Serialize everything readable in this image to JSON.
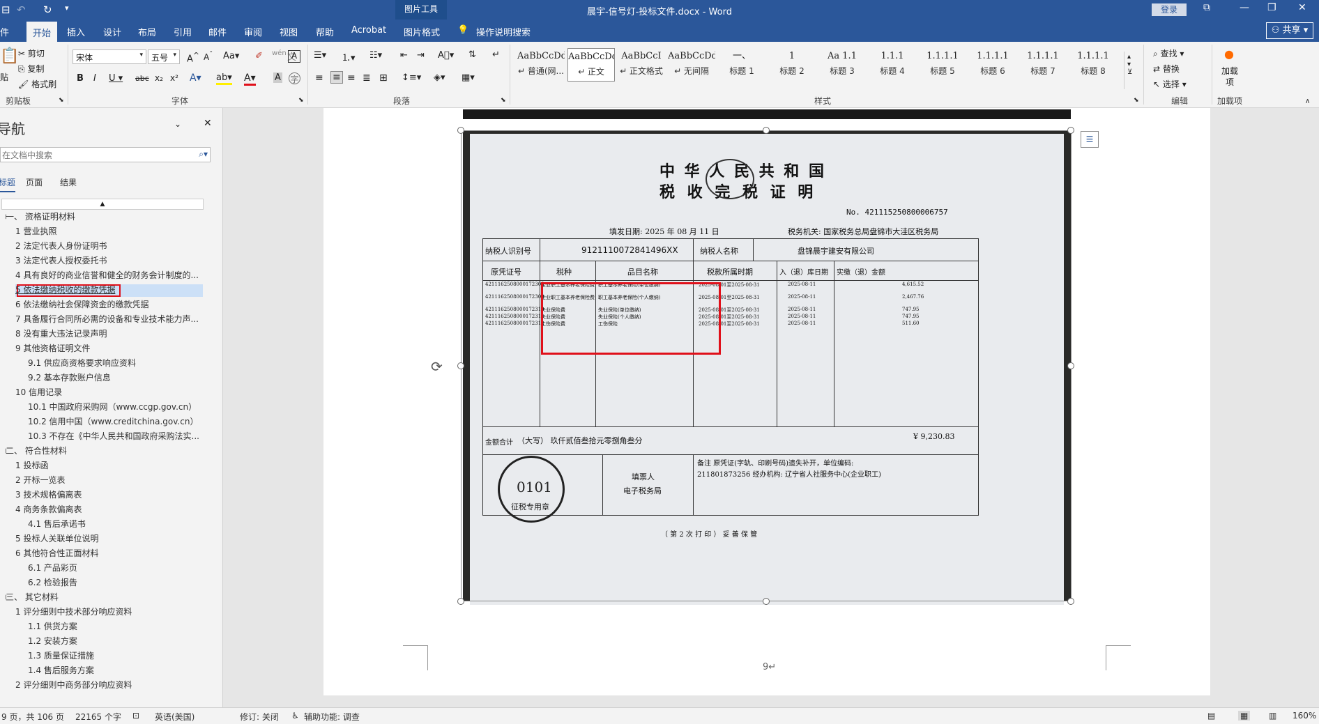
{
  "titlebar": {
    "context_tab": "图片工具",
    "doc_title": "晨宇-信号灯-投标文件.docx  -  Word",
    "login": "登录"
  },
  "tabs": [
    {
      "label": "件"
    },
    {
      "label": "开始"
    },
    {
      "label": "插入"
    },
    {
      "label": "设计"
    },
    {
      "label": "布局"
    },
    {
      "label": "引用"
    },
    {
      "label": "邮件"
    },
    {
      "label": "审阅"
    },
    {
      "label": "视图"
    },
    {
      "label": "帮助"
    },
    {
      "label": "Acrobat"
    },
    {
      "label": "图片格式"
    }
  ],
  "tell_me": "操作说明搜索",
  "share": "共享",
  "ribbon": {
    "clipboard": {
      "paste": "贴",
      "cut": "剪切",
      "copy": "复制",
      "format_painter": "格式刷",
      "label": "剪贴板"
    },
    "font": {
      "name": "宋体",
      "size": "五号",
      "label": "字体"
    },
    "paragraph": {
      "label": "段落"
    },
    "styles": {
      "label": "样式",
      "items": [
        {
          "preview": "AaBbCcDd",
          "name": "↵ 普通(网..."
        },
        {
          "preview": "AaBbCcDd",
          "name": "↵ 正文"
        },
        {
          "preview": "AaBbCcI",
          "name": "↵ 正文格式"
        },
        {
          "preview": "AaBbCcDdI",
          "name": "↵ 无间隔"
        },
        {
          "preview": "一、",
          "name": "标题 1"
        },
        {
          "preview": "1",
          "name": "标题 2"
        },
        {
          "preview": "Aa 1.1",
          "name": "标题 3"
        },
        {
          "preview": "1.1.1",
          "name": "标题 4"
        },
        {
          "preview": "1.1.1.1",
          "name": "标题 5"
        },
        {
          "preview": "1.1.1.1",
          "name": "标题 6"
        },
        {
          "preview": "1.1.1.1",
          "name": "标题 7"
        },
        {
          "preview": "1.1.1.1",
          "name": "标题 8"
        }
      ]
    },
    "editing": {
      "find": "查找",
      "replace": "替换",
      "select": "选择",
      "label": "编辑"
    },
    "addins": {
      "add": "加载项",
      "label": "加载项"
    }
  },
  "nav": {
    "title": "导航",
    "search_placeholder": "在文档中搜索",
    "tabs": [
      "标题",
      "页面",
      "结果"
    ],
    "items": [
      {
        "text": "一、 资格证明材料",
        "indent": 0,
        "arrow": "◢"
      },
      {
        "text": "1 营业执照",
        "indent": 1
      },
      {
        "text": "2 法定代表人身份证明书",
        "indent": 1
      },
      {
        "text": "3 法定代表人授权委托书",
        "indent": 1
      },
      {
        "text": "4 具有良好的商业信誉和健全的财务会计制度的...",
        "indent": 1
      },
      {
        "text": "5 依法缴纳税收的缴款凭据",
        "indent": 1,
        "selected": true
      },
      {
        "text": "6 依法缴纳社会保障资金的缴款凭据",
        "indent": 1
      },
      {
        "text": "7 具备履行合同所必需的设备和专业技术能力声...",
        "indent": 1
      },
      {
        "text": "8 没有重大违法记录声明",
        "indent": 1
      },
      {
        "text": "9 其他资格证明文件",
        "indent": 1,
        "arrow": "◢"
      },
      {
        "text": "9.1 供应商资格要求响应资料",
        "indent": 2,
        "arrow": "▷"
      },
      {
        "text": "9.2 基本存款账户信息",
        "indent": 2
      },
      {
        "text": "10 信用记录",
        "indent": 1,
        "arrow": "◢"
      },
      {
        "text": "10.1 中国政府采购网（www.ccgp.gov.cn）",
        "indent": 2,
        "arrow": "▷"
      },
      {
        "text": "10.2 信用中国（www.creditchina.gov.cn）",
        "indent": 2,
        "arrow": "▷"
      },
      {
        "text": "10.3 不存在《中华人民共和国政府采购法实...",
        "indent": 2
      },
      {
        "text": "二、 符合性材料",
        "indent": 0,
        "arrow": "◢"
      },
      {
        "text": "1 投标函",
        "indent": 1
      },
      {
        "text": "2 开标一览表",
        "indent": 1
      },
      {
        "text": "3 技术规格偏离表",
        "indent": 1
      },
      {
        "text": "4 商务条款偏离表",
        "indent": 1,
        "arrow": "◢"
      },
      {
        "text": "4.1 售后承诺书",
        "indent": 2
      },
      {
        "text": "5 投标人关联单位说明",
        "indent": 1
      },
      {
        "text": "6 其他符合性正面材料",
        "indent": 1,
        "arrow": "◢"
      },
      {
        "text": "6.1 产品彩页",
        "indent": 2,
        "arrow": "▷"
      },
      {
        "text": "6.2 检验报告",
        "indent": 2,
        "arrow": "▷"
      },
      {
        "text": "三、 其它材料",
        "indent": 0,
        "arrow": "◢"
      },
      {
        "text": "1 评分细则中技术部分响应资料",
        "indent": 1,
        "arrow": "◢"
      },
      {
        "text": "1.1 供货方案",
        "indent": 2,
        "arrow": "▷"
      },
      {
        "text": "1.2 安装方案",
        "indent": 2,
        "arrow": "▷"
      },
      {
        "text": "1.3 质量保证措施",
        "indent": 2,
        "arrow": "▷"
      },
      {
        "text": "1.4 售后服务方案",
        "indent": 2,
        "arrow": "▷"
      },
      {
        "text": "2 评分细则中商务部分响应资料",
        "indent": 1,
        "arrow": "◢"
      }
    ]
  },
  "certificate": {
    "title1": "中 华 人 民 共 和 国",
    "title2": "税 收 完 税 证 明",
    "number": "No.  421115250800006757",
    "issue_date": "填发日期:   2025  年   08  月   11  日",
    "tax_office": "税务机关:    国家税务总局盘锦市大洼区税务局",
    "taxpayer_id_label": "纳税人识别号",
    "taxpayer_id": "9121110072841496XX",
    "taxpayer_name_label": "纳税人名称",
    "taxpayer_name": "盘锦晨宇建安有限公司",
    "headers": [
      "原凭证号",
      "税种",
      "品目名称",
      "税款所属时期",
      "入（退）库日期",
      "实缴（退）金额"
    ],
    "rows": [
      {
        "voucher": "4211162508000172308",
        "tax": "企业职工基本养老保险费",
        "item": "职工基本养老保险(单位缴纳)",
        "period": "2025-08-01至2025-08-31",
        "date": "2025-08-11",
        "amount": "4,615.52"
      },
      {
        "voucher": "4211162508000172309",
        "tax": "企业职工基本养老保险费",
        "item": "职工基本养老保险(个人缴纳)",
        "period": "2025-08-01至2025-08-31",
        "date": "2025-08-11",
        "amount": "2,467.76"
      },
      {
        "voucher": "4211162508000172310",
        "tax": "失业保险费",
        "item": "失业保险(单位缴纳)",
        "period": "2025-08-01至2025-08-31",
        "date": "2025-08-11",
        "amount": "747.95"
      },
      {
        "voucher": "4211162508000172311",
        "tax": "失业保险费",
        "item": "失业保险(个人缴纳)",
        "period": "2025-08-01至2025-08-31",
        "date": "2025-08-11",
        "amount": "747.95"
      },
      {
        "voucher": "4211162508000172312",
        "tax": "工伤保险费",
        "item": "工伤保险",
        "period": "2025-08-01至2025-08-31",
        "date": "2025-08-11",
        "amount": "511.60"
      }
    ],
    "total_label": "金额合计",
    "total_words": "（大写）  玖仟贰佰叁拾元零捌角叁分",
    "total_amount": "¥ 9,230.83",
    "filler_label": "填票人",
    "filler": "电子税务局",
    "remark": "备注 原凭证(字轨、印刷号码)遗失补开，单位编码:",
    "remark2": "211801873256  经办机构: 辽宁省人社服务中心(企业职工)",
    "stamp_code": "0101",
    "stamp_text": "征税专用章",
    "footer": "（ 第 2 次 打 印 ） 妥 善 保 管"
  },
  "page_number": "9↵",
  "status": {
    "page": "9 页，共 106 页",
    "words": "22165 个字",
    "lang": "英语(美国)",
    "track": "修订: 关闭",
    "access": "辅助功能: 调查",
    "zoom": "160%"
  },
  "colors": {
    "accent": "#2b579a",
    "highlight_red": "#e0101a",
    "nav_selected": "#cce0f7"
  }
}
